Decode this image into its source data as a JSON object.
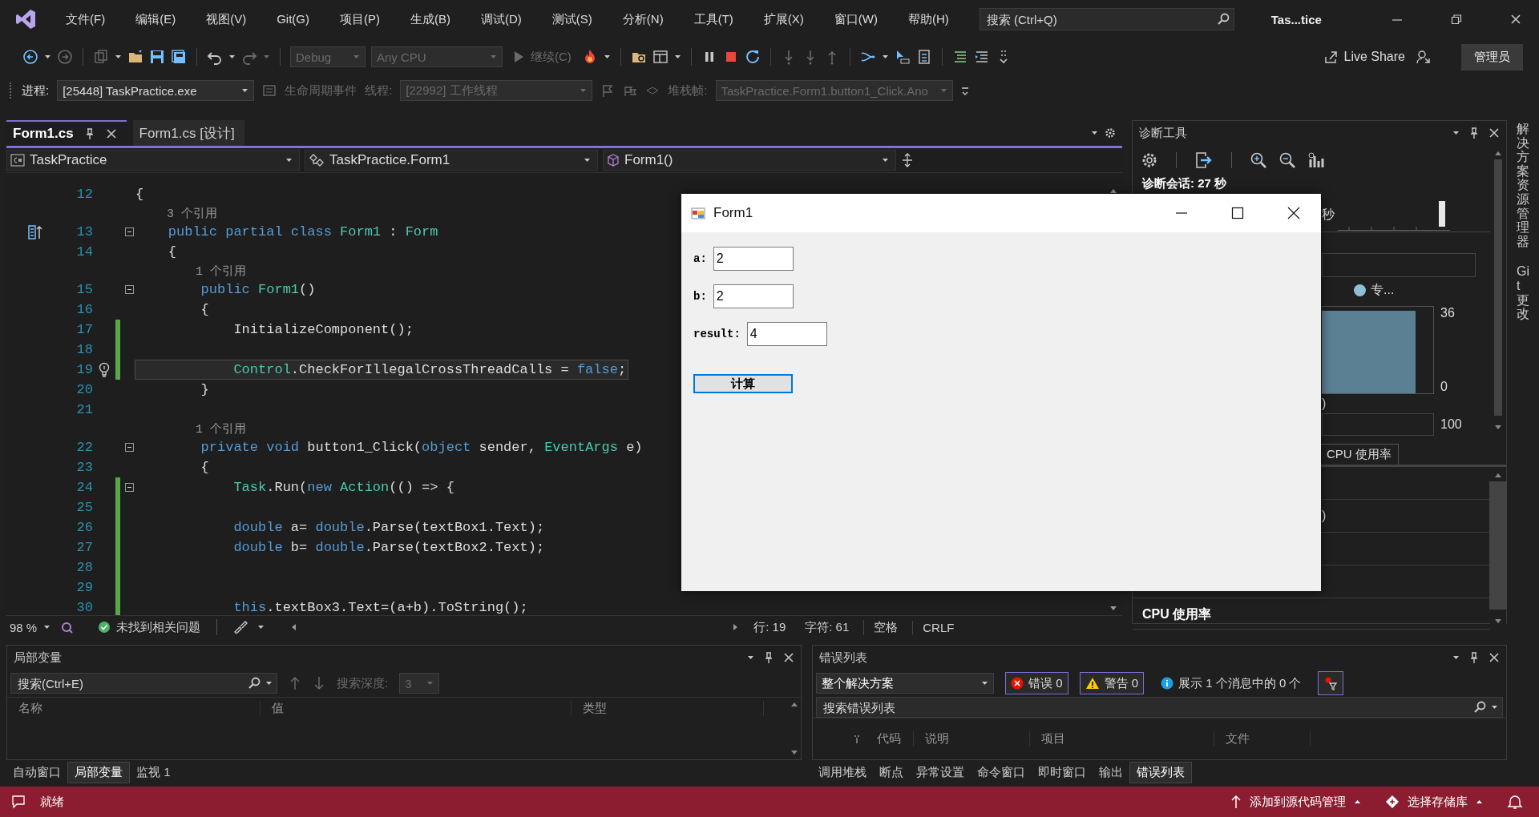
{
  "menu_bar": {
    "menus": [
      "文件(F)",
      "编辑(E)",
      "视图(V)",
      "Git(G)",
      "项目(P)",
      "生成(B)",
      "调试(D)",
      "测试(S)",
      "分析(N)",
      "工具(T)",
      "扩展(X)",
      "窗口(W)",
      "帮助(H)"
    ],
    "search": {
      "placeholder": "搜索 (Ctrl+Q)"
    },
    "solution_name": "Tas...tice"
  },
  "standard_toolbar": {
    "configuration": {
      "value": "Debug",
      "disabled": true
    },
    "platform": {
      "value": "Any CPU",
      "disabled": true
    },
    "continue_button": {
      "label": "继续(C)",
      "disabled": true
    },
    "live_share": "Live Share",
    "account_button": "管理员"
  },
  "debug_location_toolbar": {
    "process_label": "进程:",
    "process": {
      "value": "[25448] TaskPractice.exe",
      "disabled": false
    },
    "lifecycle_events": {
      "label": "生命周期事件",
      "disabled": true
    },
    "thread_label": {
      "label": "线程:",
      "disabled": true
    },
    "thread": {
      "value": "[22992] 工作线程",
      "disabled": true
    },
    "stack_frame_label": {
      "label": "堆栈帧:",
      "disabled": true
    },
    "stack_frame": {
      "value": "TaskPractice.Form1.button1_Click.Ano",
      "disabled": true
    }
  },
  "document_tabs": [
    {
      "label": "Form1.cs",
      "selected": true
    },
    {
      "label": "Form1.cs [设计]",
      "selected": false
    }
  ],
  "navigation_bar": {
    "project": "TaskPractice",
    "type": "TaskPractice.Form1",
    "member": "Form1()"
  },
  "editor": {
    "lines": [
      {
        "kind": "code",
        "number": "12",
        "tokens": [
          {
            "text": "{",
            "kind": "plain"
          }
        ],
        "changed": false,
        "current": false,
        "foldable": false
      },
      {
        "kind": "lens",
        "text": "    3 个引用"
      },
      {
        "kind": "code",
        "number": "13",
        "tokens": [
          {
            "text": "    public partial class ",
            "kind": "keyword"
          },
          {
            "text": "Form1",
            "kind": "type"
          },
          {
            "text": " : ",
            "kind": "plain"
          },
          {
            "text": "Form",
            "kind": "type"
          }
        ],
        "changed": false,
        "current": false,
        "foldable": true,
        "implementation_marker": true
      },
      {
        "kind": "code",
        "number": "14",
        "tokens": [
          {
            "text": "    {",
            "kind": "plain"
          }
        ],
        "changed": false,
        "current": false,
        "foldable": false
      },
      {
        "kind": "lens",
        "text": "        1 个引用"
      },
      {
        "kind": "code",
        "number": "15",
        "tokens": [
          {
            "text": "        public ",
            "kind": "keyword"
          },
          {
            "text": "Form1",
            "kind": "type"
          },
          {
            "text": "()",
            "kind": "plain"
          }
        ],
        "changed": false,
        "current": false,
        "foldable": true
      },
      {
        "kind": "code",
        "number": "16",
        "tokens": [
          {
            "text": "        {",
            "kind": "plain"
          }
        ],
        "changed": false,
        "current": false,
        "foldable": false
      },
      {
        "kind": "code",
        "number": "17",
        "tokens": [
          {
            "text": "            InitializeComponent();",
            "kind": "plain"
          }
        ],
        "changed": true,
        "current": false,
        "foldable": false
      },
      {
        "kind": "code",
        "number": "18",
        "changed": true,
        "current": false,
        "foldable": false
      },
      {
        "kind": "code",
        "number": "19",
        "tokens": [
          {
            "text": "            Control",
            "kind": "type"
          },
          {
            "text": ".CheckForIllegalCrossThreadCalls = ",
            "kind": "plain"
          },
          {
            "text": "false",
            "kind": "keyword"
          },
          {
            "text": ";",
            "kind": "plain"
          }
        ],
        "changed": true,
        "current": true,
        "foldable": false,
        "lightbulb": true
      },
      {
        "kind": "code",
        "number": "20",
        "tokens": [
          {
            "text": "        }",
            "kind": "plain"
          }
        ],
        "changed": false,
        "current": false,
        "foldable": false
      },
      {
        "kind": "code",
        "number": "21",
        "changed": false,
        "current": false,
        "foldable": false
      },
      {
        "kind": "lens",
        "text": "        1 个引用"
      },
      {
        "kind": "code",
        "number": "22",
        "tokens": [
          {
            "text": "        private void",
            "kind": "keyword"
          },
          {
            "text": " button1_Click(",
            "kind": "plain"
          },
          {
            "text": "object",
            "kind": "keyword"
          },
          {
            "text": " sender, ",
            "kind": "plain"
          },
          {
            "text": "EventArgs",
            "kind": "type"
          },
          {
            "text": " e)",
            "kind": "plain"
          }
        ],
        "changed": false,
        "current": false,
        "foldable": true
      },
      {
        "kind": "code",
        "number": "23",
        "tokens": [
          {
            "text": "        {",
            "kind": "plain"
          }
        ],
        "changed": false,
        "current": false,
        "foldable": false
      },
      {
        "kind": "code",
        "number": "24",
        "tokens": [
          {
            "text": "            Task",
            "kind": "type"
          },
          {
            "text": ".Run(",
            "kind": "plain"
          },
          {
            "text": "new ",
            "kind": "keyword"
          },
          {
            "text": "Action",
            "kind": "type"
          },
          {
            "text": "(() => {",
            "kind": "plain"
          }
        ],
        "changed": true,
        "current": false,
        "foldable": true
      },
      {
        "kind": "code",
        "number": "25",
        "changed": true,
        "current": false,
        "foldable": false
      },
      {
        "kind": "code",
        "number": "26",
        "tokens": [
          {
            "text": "            double",
            "kind": "keyword"
          },
          {
            "text": " a= ",
            "kind": "plain"
          },
          {
            "text": "double",
            "kind": "keyword"
          },
          {
            "text": ".Parse(textBox1.Text);",
            "kind": "plain"
          }
        ],
        "changed": true,
        "current": false,
        "foldable": false
      },
      {
        "kind": "code",
        "number": "27",
        "tokens": [
          {
            "text": "            double",
            "kind": "keyword"
          },
          {
            "text": " b= ",
            "kind": "plain"
          },
          {
            "text": "double",
            "kind": "keyword"
          },
          {
            "text": ".Parse(textBox2.Text);",
            "kind": "plain"
          }
        ],
        "changed": true,
        "current": false,
        "foldable": false
      },
      {
        "kind": "code",
        "number": "28",
        "changed": true,
        "current": false,
        "foldable": false
      },
      {
        "kind": "code",
        "number": "29",
        "changed": true,
        "current": false,
        "foldable": false
      },
      {
        "kind": "code",
        "number": "30",
        "tokens": [
          {
            "text": "            this",
            "kind": "keyword"
          },
          {
            "text": ".textBox3.Text=(a+b).ToString();",
            "kind": "plain"
          }
        ],
        "changed": true,
        "current": false,
        "foldable": false
      }
    ]
  },
  "editor_status": {
    "zoom": "98 %",
    "issues": "未找到相关问题",
    "line": "行: 19",
    "column": "字符: 61",
    "indentation": "空格",
    "line_ending": "CRLF"
  },
  "diagnostics": {
    "title": "诊断工具",
    "session": "诊断会话: 27 秒",
    "timeline_unit": "秒",
    "legend_label": "专...",
    "chart_max": "36",
    "chart_min": "0",
    "column_1": ")",
    "cpu_max": "100",
    "tab": "CPU 使用率",
    "row_text": ")",
    "section_title": "CPU 使用率"
  },
  "side_tabs": [
    "解决方案资源管理器",
    "Git 更改"
  ],
  "locals": {
    "title": "局部变量",
    "search": {
      "placeholder": "搜索(Ctrl+E)"
    },
    "depth_label": "搜索深度:",
    "depth": {
      "value": "3",
      "disabled": true
    },
    "columns": [
      "名称",
      "值",
      "类型"
    ],
    "tabs": [
      {
        "label": "自动窗口",
        "selected": false
      },
      {
        "label": "局部变量",
        "selected": true
      },
      {
        "label": "监视 1",
        "selected": false
      }
    ]
  },
  "error_list": {
    "title": "错误列表",
    "scope": "整个解决方案",
    "filters": [
      {
        "kind": "error",
        "label": "错误 0",
        "selected": true
      },
      {
        "kind": "warning",
        "label": "警告 0",
        "selected": true
      },
      {
        "kind": "message",
        "label": "展示 1 个消息中的 0 个",
        "selected": false
      }
    ],
    "search": {
      "placeholder": "搜索错误列表"
    },
    "columns": [
      "代码",
      "说明",
      "项目",
      "文件"
    ],
    "tabs": [
      {
        "label": "调用堆栈",
        "selected": false
      },
      {
        "label": "断点",
        "selected": false
      },
      {
        "label": "异常设置",
        "selected": false
      },
      {
        "label": "命令窗口",
        "selected": false
      },
      {
        "label": "即时窗口",
        "selected": false
      },
      {
        "label": "输出",
        "selected": false
      },
      {
        "label": "错误列表",
        "selected": true
      }
    ]
  },
  "status_bar": {
    "message": "就绪",
    "source_control": "添加到源代码管理",
    "repository": "选择存储库"
  },
  "form_window": {
    "title": "Form1",
    "fields": [
      {
        "label": "a:",
        "value": "2"
      },
      {
        "label": "b:",
        "value": "2"
      },
      {
        "label": "result:",
        "value": "4"
      }
    ],
    "button": {
      "label": "计算",
      "focused": true
    }
  }
}
